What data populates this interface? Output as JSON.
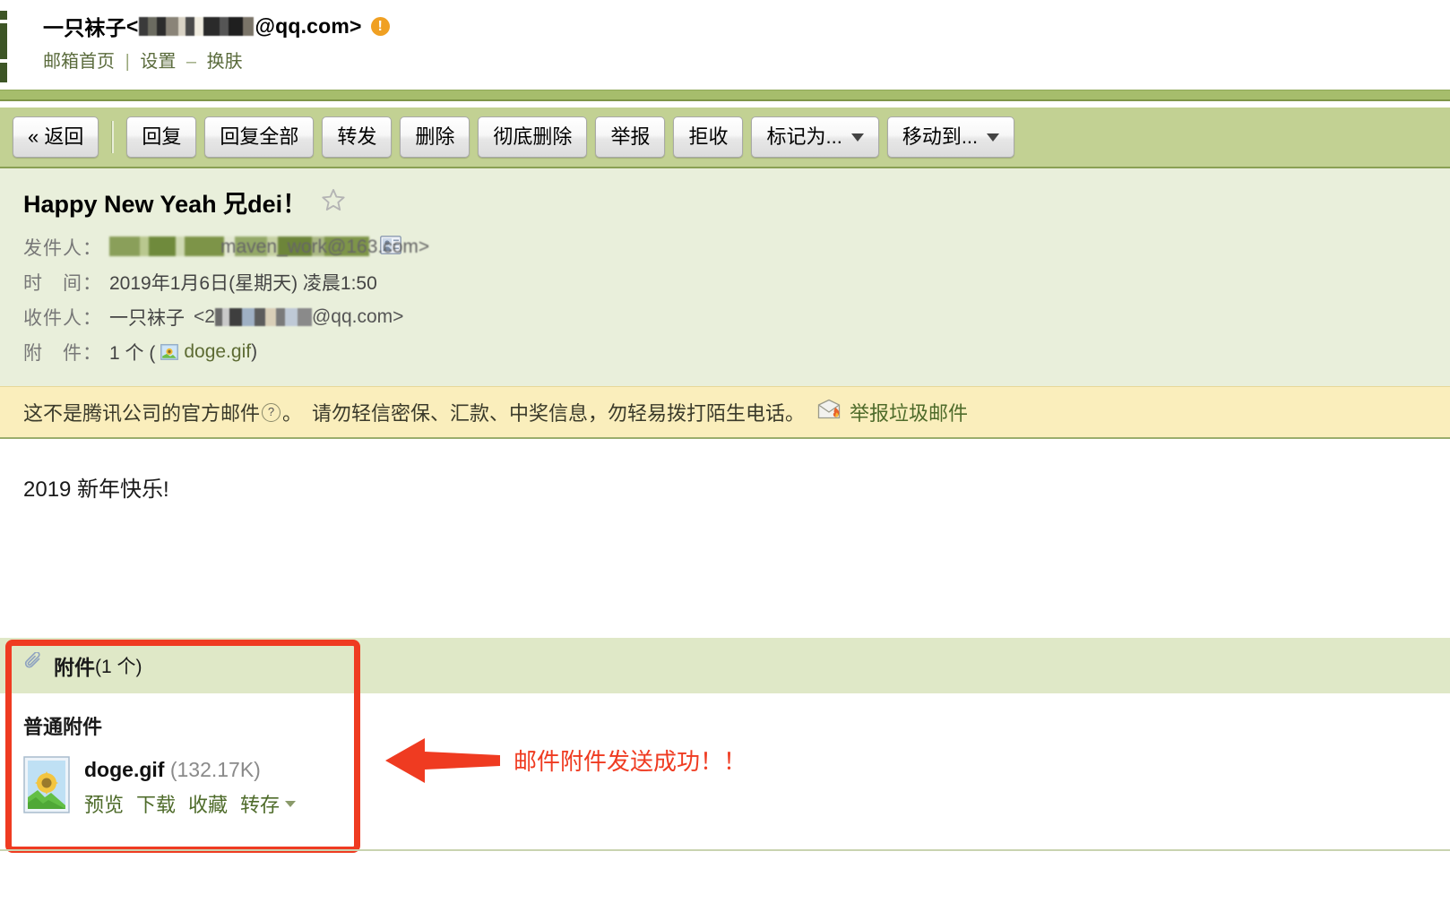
{
  "header": {
    "account_name": "一只袜子",
    "account_email_suffix": "@qq.com>",
    "account_open_bracket": "<",
    "warning_badge": "!",
    "links": {
      "mailbox_home": "邮箱首页",
      "separator": "|",
      "settings": "设置",
      "dash": "–",
      "skin": "换肤"
    }
  },
  "toolbar": {
    "back": "« 返回",
    "reply": "回复",
    "reply_all": "回复全部",
    "forward": "转发",
    "delete": "删除",
    "delete_permanently": "彻底删除",
    "report": "举报",
    "reject": "拒收",
    "mark_as": "标记为...",
    "move_to": "移动到..."
  },
  "mail": {
    "subject": "Happy New Yeah 兄dei！",
    "star_icon": "star-outline-icon",
    "from_label": "发件人：",
    "from_value_visible": "maven_work@163.com>",
    "from_open_bracket": "<",
    "contact_card_icon": "contact-card-icon",
    "time_label": "时　间：",
    "time_value": "2019年1月6日(星期天) 凌晨1:50",
    "to_label": "收件人：",
    "to_name": "一只袜子",
    "to_open_bracket": "<2",
    "to_email_suffix": "@qq.com>",
    "attach_label": "附　件：",
    "attach_count_text": "1 个 (",
    "attach_file_name": "doge.gif",
    "attach_close": ")"
  },
  "warning_bar": {
    "text_before_q": "这不是腾讯公司的官方邮件",
    "question_mark": "?",
    "text_after_q": "。　请勿轻信密保、汇款、中奖信息，勿轻易拨打陌生电话。",
    "spam_icon": "spam-report-icon",
    "report_spam_link": "举报垃圾邮件"
  },
  "body": {
    "content": "2019 新年快乐!"
  },
  "attachments": {
    "clip_icon": "paperclip-icon",
    "header_title": "附件",
    "header_count": "(1 个)",
    "kind_label": "普通附件",
    "file_thumb_icon": "image-file-icon",
    "file_name": "doge.gif",
    "file_size": "(132.17K)",
    "actions": {
      "preview": "预览",
      "download": "下载",
      "favorite": "收藏",
      "save_to": "转存"
    }
  },
  "annotation": {
    "arrow_icon": "left-arrow-annotation",
    "text": "邮件附件发送成功！！",
    "color": "#ef3b21"
  },
  "colors": {
    "toolbar_green": "#c2d193",
    "band_green": "#a6bd6c",
    "mail_head_green": "#e9efdb",
    "warning_yellow": "#faeebc",
    "attachment_header_green": "#dfe8c7",
    "link_green": "#4e6b2a",
    "warn_badge_orange": "#f0a022",
    "annotation_red": "#ef3b21"
  }
}
